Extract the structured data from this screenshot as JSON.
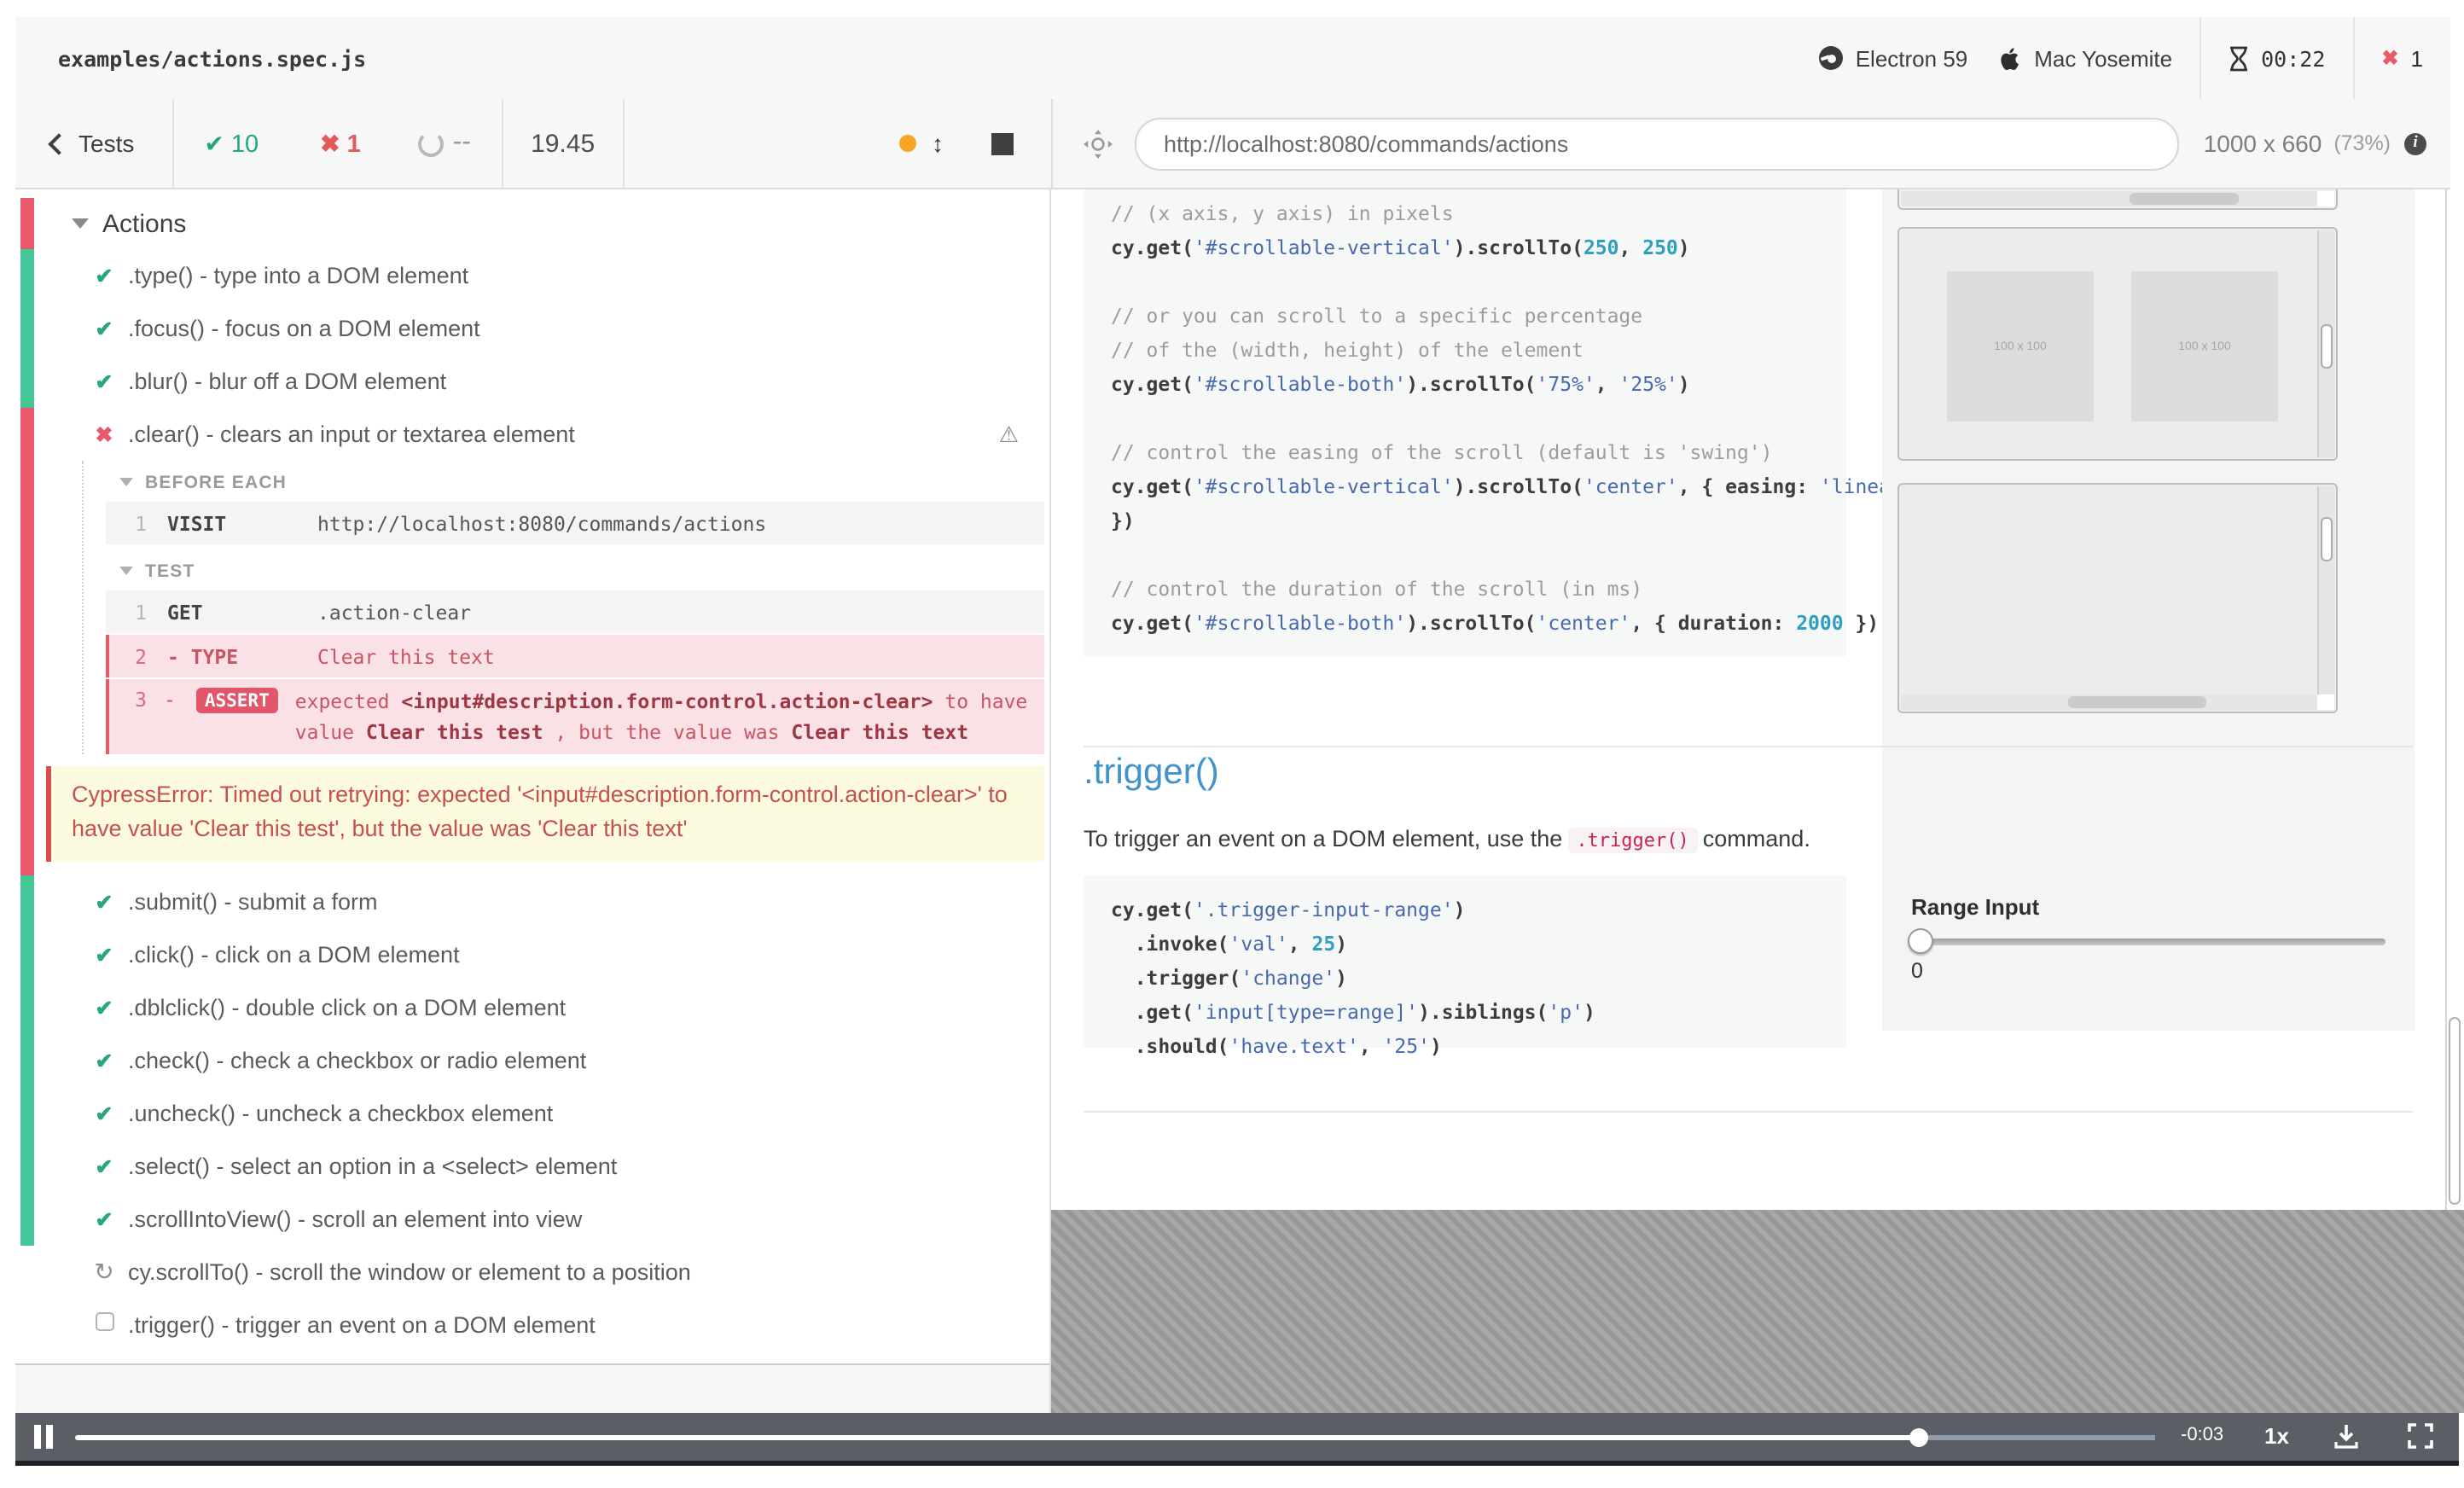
{
  "header": {
    "spec": "examples/actions.spec.js",
    "browser": "Electron 59",
    "os": "Mac Yosemite",
    "timer": "00:22",
    "failed_count": "1",
    "fail_mark": "✖"
  },
  "toolbar": {
    "back_label": "Tests",
    "passed": "10",
    "failed": "1",
    "pending": "--",
    "duration": "19.45",
    "pass_mark": "✔",
    "fail_mark": "✖",
    "url": "http://localhost:8080/commands/actions",
    "viewport": "1000 x 660",
    "zoom": "(73%)",
    "updown_glyph": "↕"
  },
  "reporter": {
    "suite": "Actions",
    "passing_a": [
      {
        "s": "p",
        "label": ".type() - type into a DOM element"
      },
      {
        "s": "p",
        "label": ".focus() - focus on a DOM element"
      },
      {
        "s": "p",
        "label": ".blur() - blur off a DOM element"
      }
    ],
    "failing": {
      "label": ".clear() - clears an input or textarea element",
      "warn_glyph": "⚠",
      "detail": {
        "before_each_label": "BEFORE EACH",
        "visit": {
          "n": "1",
          "cmd": "VISIT",
          "msg": "http://localhost:8080/commands/actions"
        },
        "test_label": "TEST",
        "get": {
          "n": "1",
          "cmd": "GET",
          "msg": ".action-clear"
        },
        "type": {
          "n": "2",
          "cmd": "- TYPE",
          "msg": "Clear this text"
        },
        "assert": {
          "n": "3",
          "dash": "-",
          "badge": "ASSERT",
          "tokens": [
            [
              "r",
              "expected "
            ],
            [
              "b",
              "<input#description.form-control.action-clear>"
            ],
            [
              "r",
              " to have value "
            ],
            [
              "b",
              "Clear this test"
            ],
            [
              "r",
              " , but the value was "
            ],
            [
              "b",
              "Clear this text"
            ]
          ]
        },
        "error": "CypressError: Timed out retrying: expected '<input#description.form-control.action-clear>' to have value 'Clear this test', but the value was 'Clear this text'"
      }
    },
    "passing_b": [
      {
        "s": "p",
        "label": ".submit() - submit a form"
      },
      {
        "s": "p",
        "label": ".click() - click on a DOM element"
      },
      {
        "s": "p",
        "label": ".dblclick() - double click on a DOM element"
      },
      {
        "s": "p",
        "label": ".check() - check a checkbox or radio element"
      },
      {
        "s": "p",
        "label": ".uncheck() - uncheck a checkbox element"
      },
      {
        "s": "p",
        "label": ".select() - select an option in a <select> element"
      },
      {
        "s": "p",
        "label": ".scrollIntoView() - scroll an element into view"
      }
    ],
    "pending": [
      {
        "s": "r",
        "label": "cy.scrollTo() - scroll the window or element to a position"
      },
      {
        "s": "b",
        "label": ".trigger() - trigger an event on a DOM element"
      }
    ]
  },
  "aut": {
    "code_block_1": [
      [
        [
          "cm",
          "// (x axis, y axis) in pixels"
        ]
      ],
      [
        [
          "pl",
          "cy.get("
        ],
        [
          "st",
          "'#scrollable-vertical'"
        ],
        [
          "pl",
          ").scrollTo("
        ],
        [
          "nu",
          "250"
        ],
        [
          "pl",
          ", "
        ],
        [
          "nu",
          "250"
        ],
        [
          "pl",
          ")"
        ]
      ],
      [],
      [
        [
          "cm",
          "// or you can scroll to a specific percentage"
        ]
      ],
      [
        [
          "cm",
          "// of the (width, height) of the element"
        ]
      ],
      [
        [
          "pl",
          "cy.get("
        ],
        [
          "st",
          "'#scrollable-both'"
        ],
        [
          "pl",
          ").scrollTo("
        ],
        [
          "st",
          "'75%'"
        ],
        [
          "pl",
          ", "
        ],
        [
          "st",
          "'25%'"
        ],
        [
          "pl",
          ")"
        ]
      ],
      [],
      [
        [
          "cm",
          "// control the easing of the scroll (default is 'swing')"
        ]
      ],
      [
        [
          "pl",
          "cy.get("
        ],
        [
          "st",
          "'#scrollable-vertical'"
        ],
        [
          "pl",
          ").scrollTo("
        ],
        [
          "st",
          "'center'"
        ],
        [
          "pl",
          ", { easing: "
        ],
        [
          "st",
          "'linear'"
        ]
      ],
      [
        [
          "pl",
          "})"
        ]
      ],
      [],
      [
        [
          "cm",
          "// control the duration of the scroll (in ms)"
        ]
      ],
      [
        [
          "pl",
          "cy.get("
        ],
        [
          "st",
          "'#scrollable-both'"
        ],
        [
          "pl",
          ").scrollTo("
        ],
        [
          "st",
          "'center'"
        ],
        [
          "pl",
          ", { duration: "
        ],
        [
          "nu",
          "2000"
        ],
        [
          "pl",
          " })"
        ]
      ]
    ],
    "img_placeholder": "100 x 100",
    "trigger": {
      "heading": ".trigger()",
      "desc_before": "To trigger an event on a DOM element, use the",
      "desc_code": ".trigger()",
      "desc_after": "command.",
      "code_block_2": [
        [
          [
            "pl",
            "cy.get("
          ],
          [
            "st",
            "'.trigger-input-range'"
          ],
          [
            "pl",
            ")"
          ]
        ],
        [
          [
            "pl",
            "  .invoke("
          ],
          [
            "st",
            "'val'"
          ],
          [
            "pl",
            ", "
          ],
          [
            "nu",
            "25"
          ],
          [
            "pl",
            ")"
          ]
        ],
        [
          [
            "pl",
            "  .trigger("
          ],
          [
            "st",
            "'change'"
          ],
          [
            "pl",
            ")"
          ]
        ],
        [
          [
            "pl",
            "  .get("
          ],
          [
            "st",
            "'input[type=range]'"
          ],
          [
            "pl",
            ").siblings("
          ],
          [
            "st",
            "'p'"
          ],
          [
            "pl",
            ")"
          ]
        ],
        [
          [
            "pl",
            "  .should("
          ],
          [
            "st",
            "'have.text'"
          ],
          [
            "pl",
            ", "
          ],
          [
            "st",
            "'25'"
          ],
          [
            "pl",
            ")"
          ]
        ]
      ]
    },
    "range": {
      "label": "Range Input",
      "value": "0"
    }
  },
  "player": {
    "time_remaining": "-0:03",
    "speed": "1x"
  },
  "colors": {
    "pass_green": "#26a879",
    "strip_green": "#46c596",
    "fail_red": "#e8596a",
    "accent_yellow": "#f5a623"
  }
}
